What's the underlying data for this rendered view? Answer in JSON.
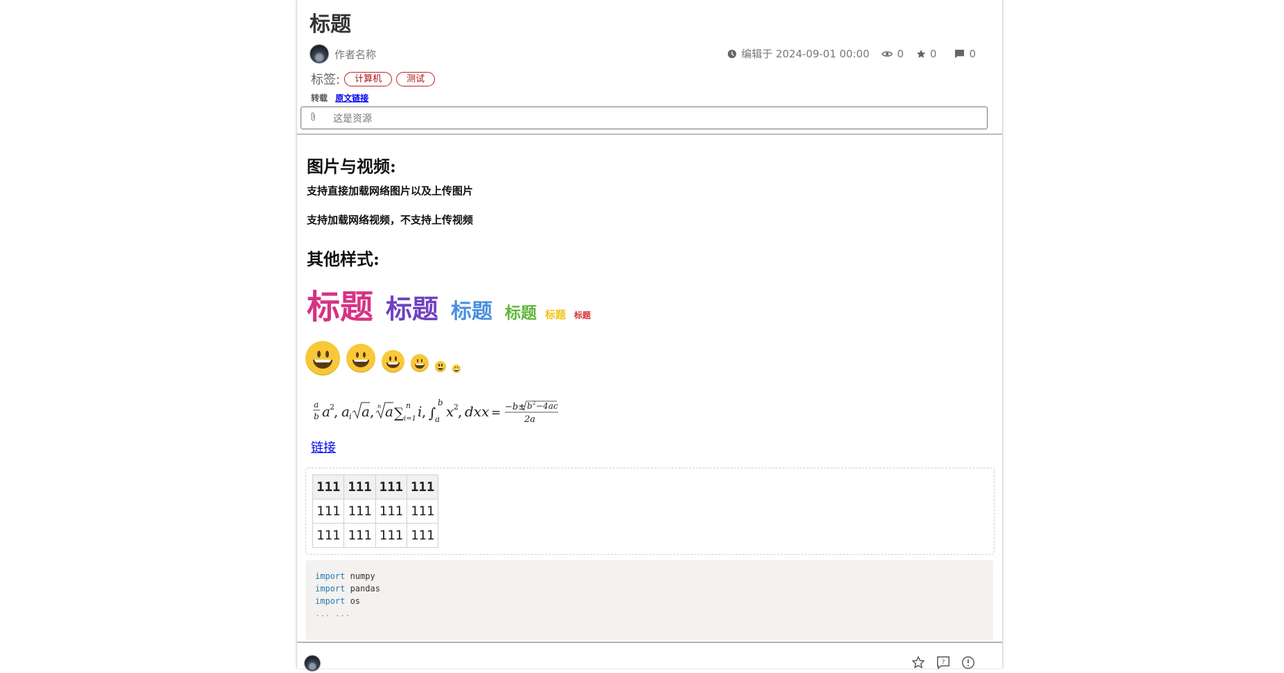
{
  "post": {
    "title": "标题",
    "author": "作者名称",
    "edited": "编辑于 2024-09-01 00:00",
    "views": "0",
    "stars": "0",
    "comments": "0",
    "tags_label": "标签:",
    "tags": [
      "计算机",
      "测试"
    ],
    "repost_label": "转载",
    "source_link": "原文链接",
    "resource_text": "这是资源"
  },
  "content": {
    "section1_title": "图片与视频:",
    "line1": "支持直接加载网络图片以及上传图片",
    "line2": "支持加载网络视频，不支持上传视频",
    "section2_title": "其他样式:",
    "rainbow_text": "标题",
    "rainbow_colors": [
      "#d63384",
      "#6f42c1",
      "#4a8fe0",
      "#5fb53a",
      "#f0c419",
      "#d63333"
    ],
    "link_text": "链接",
    "table": {
      "headers": [
        "111",
        "111",
        "111",
        "111"
      ],
      "rows": [
        [
          "111",
          "111",
          "111",
          "111"
        ],
        [
          "111",
          "111",
          "111",
          "111"
        ]
      ]
    },
    "code": {
      "lines": [
        {
          "kw": "import",
          "mod": " numpy"
        },
        {
          "kw": "import",
          "mod": " pandas"
        },
        {
          "kw": "import",
          "mod": " os"
        }
      ],
      "ellipsis": "... ..."
    }
  }
}
